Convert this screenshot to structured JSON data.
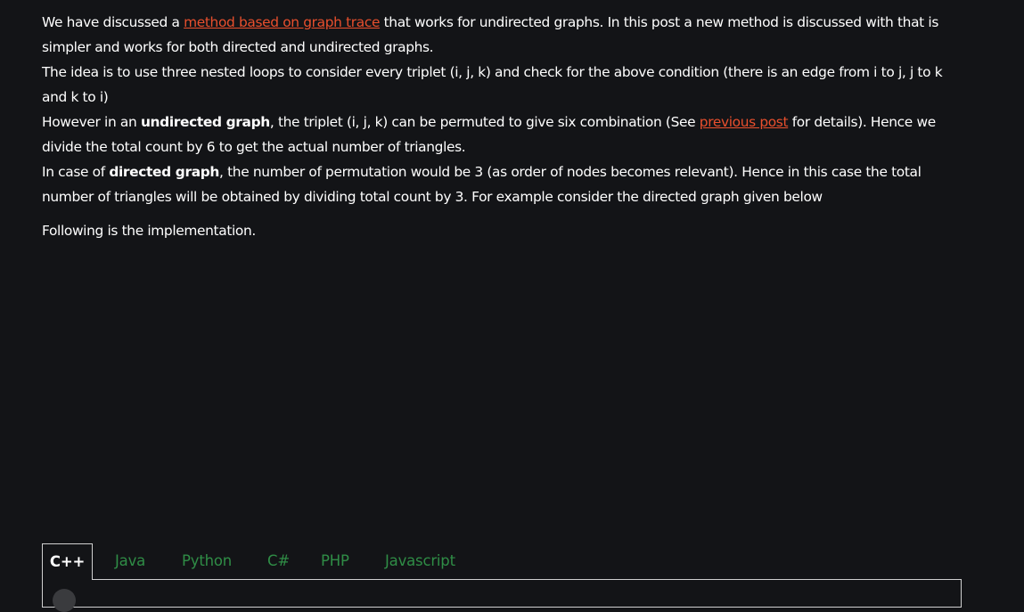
{
  "article": {
    "p1": {
      "before": "We have discussed a ",
      "link": "method based on graph trace",
      "after": " that works for undirected graphs. In this post a new method is discussed with that is simpler and works for both directed and undirected graphs."
    },
    "p2": "The idea is to use three nested loops to consider every triplet (i, j, k) and check for the above condition (there is an edge from i to j, j to k and k to i)",
    "p3": {
      "before": "However in an ",
      "bold": "undirected graph",
      "middle": ", the triplet (i, j, k) can be permuted to give six combination (See ",
      "link": "previous post",
      "after": " for details). Hence we divide the total count by 6 to get the actual number of triangles."
    },
    "p4": {
      "before": "In case of ",
      "bold": "directed graph",
      "after": ", the number of permutation would be 3 (as order of nodes becomes relevant). Hence in this case the total number of triangles will be obtained by dividing total count by 3. For example consider the directed graph given below"
    },
    "p5": "Following is the implementation."
  },
  "code_tabs": {
    "active": "C++",
    "items": [
      "C++",
      "Java",
      "Python",
      "C#",
      "PHP",
      "Javascript"
    ]
  },
  "colors": {
    "background": "#131417",
    "text": "#ffffff",
    "link": "#e94f2d",
    "tab_inactive": "#2f8d46"
  }
}
